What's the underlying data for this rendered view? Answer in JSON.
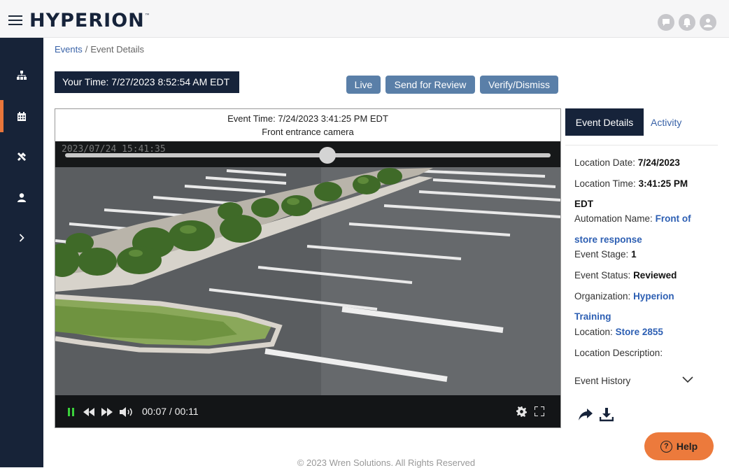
{
  "header": {
    "brand": "HYPERION",
    "trademark": "™",
    "icons": [
      "chat-bubble-icon",
      "notification-bell-icon",
      "user-profile-icon"
    ]
  },
  "sidebar": {
    "items": [
      {
        "icon": "sitemap-icon",
        "active": false
      },
      {
        "icon": "calendar-icon",
        "active": true
      },
      {
        "icon": "tools-icon",
        "active": false
      },
      {
        "icon": "user-icon",
        "active": false
      },
      {
        "icon": "chevron-right-icon",
        "active": false
      }
    ],
    "active_color": "#e8763b"
  },
  "breadcrumb": {
    "link": "Events",
    "separator": "/",
    "current": "Event Details"
  },
  "your_time": "Your Time: 7/27/2023 8:52:54 AM EDT",
  "actions": {
    "live": "Live",
    "send_review": "Send for Review",
    "verify": "Verify/Dismiss"
  },
  "video": {
    "event_time": "Event Time: 7/24/2023 3:41:25 PM EDT",
    "camera": "Front entrance camera",
    "overlay_timestamp": "2023/07/24 15:41:35",
    "time_display": "00:07 / 00:11",
    "progress": 0.54
  },
  "panel": {
    "tab_details": "Event Details",
    "tab_activity": "Activity",
    "location_date_label": "Location Date:",
    "location_date": "7/24/2023",
    "location_time_label": "Location Time:",
    "location_time": "3:41:25 PM",
    "location_time_tz": "EDT",
    "automation_label": "Automation Name:",
    "automation_1": "Front of",
    "automation_2": "store response",
    "stage_label": "Event Stage:",
    "stage": "1",
    "status_label": "Event Status:",
    "status": "Reviewed",
    "org_label": "Organization:",
    "org_1": "Hyperion",
    "org_2": "Training",
    "location_label": "Location:",
    "location": "Store 2855",
    "description_label": "Location Description:",
    "history": "Event History"
  },
  "help": {
    "label": "Help",
    "glyph": "?"
  },
  "footer": "© 2023 Wren Solutions. All Rights Reserved",
  "colors": {
    "navy": "#16233a",
    "button": "#5a7fa8",
    "link": "#2d5fb3",
    "help": "#ec7a3c"
  }
}
